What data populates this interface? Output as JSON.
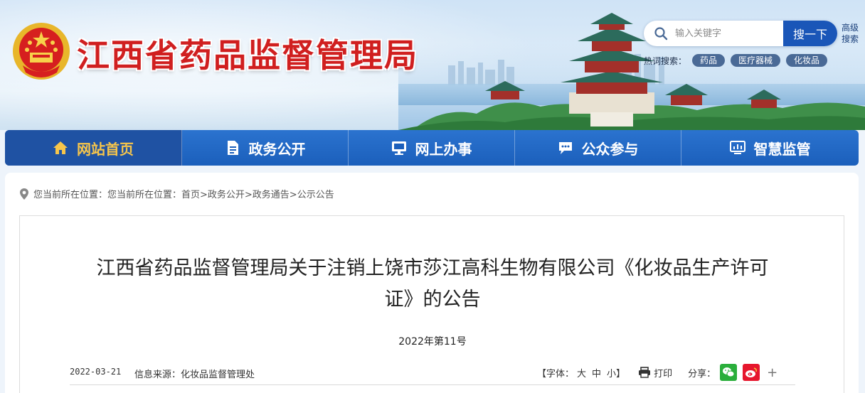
{
  "site": {
    "title": "江西省药品监督管理局"
  },
  "search": {
    "placeholder": "输入关键字",
    "button_label": "搜一下",
    "advanced_label": "高级搜索"
  },
  "hot_search": {
    "label": "热词搜索：",
    "tags": [
      "药品",
      "医疗器械",
      "化妆品"
    ]
  },
  "nav": {
    "items": [
      {
        "label": "网站首页",
        "icon": "home-icon",
        "active": true
      },
      {
        "label": "政务公开",
        "icon": "document-icon",
        "active": false
      },
      {
        "label": "网上办事",
        "icon": "monitor-icon",
        "active": false
      },
      {
        "label": "公众参与",
        "icon": "chat-icon",
        "active": false
      },
      {
        "label": "智慧监管",
        "icon": "dashboard-icon",
        "active": false
      }
    ]
  },
  "breadcrumb": {
    "prefix": "您当前所在位置：您当前所在位置：",
    "path": "首页>政务公开>政务通告>公示公告"
  },
  "article": {
    "title_line1": "江西省药品监督管理局关于注销上饶市莎江高科生物有限公司《化妆品生产许可",
    "title_line2": "证》的公告",
    "doc_number": "2022年第11号",
    "date": "2022-03-21",
    "source": "信息来源：化妆品监督管理处",
    "font_size_label": "【字体：",
    "font_large": "大",
    "font_medium": "中",
    "font_small": "小】",
    "print_label": "打印",
    "share_label": "分享：",
    "more_share": "+"
  },
  "colors": {
    "title_red": "#d01f1f",
    "nav_blue": "#1b5fbb",
    "nav_active_text": "#f6c54b",
    "search_button": "#1a56b8",
    "wechat_green": "#2aae3b",
    "weibo_red": "#e6162d"
  }
}
